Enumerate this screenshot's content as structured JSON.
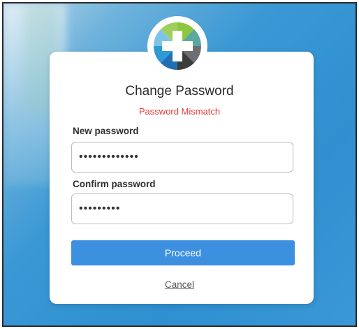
{
  "dialog": {
    "title": "Change Password",
    "error_message": "Password Mismatch",
    "new_password": {
      "label": "New password",
      "value": "•••••••••••••"
    },
    "confirm_password": {
      "label": "Confirm password",
      "value": "•••••••••"
    },
    "proceed_label": "Proceed",
    "cancel_label": "Cancel"
  },
  "colors": {
    "accent": "#3d8fe0",
    "error": "#e23b3b",
    "background": "#3a98d4"
  },
  "icons": {
    "logo": "medical-cross-logo-icon"
  }
}
